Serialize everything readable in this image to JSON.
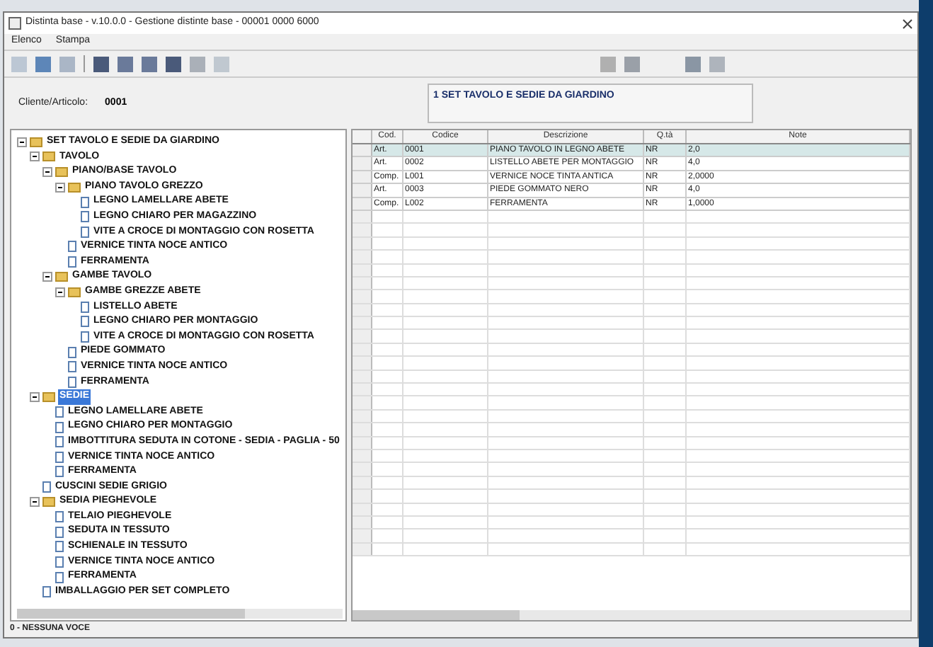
{
  "window": {
    "title": "Distinta base - v.10.0.0 - Gestione distinte base - 00001 0000 6000"
  },
  "menu": [
    "Elenco",
    "Stampa"
  ],
  "header": {
    "label": "Cliente/Articolo:",
    "value": "0001",
    "description": "1 SET TAVOLO E SEDIE DA GIARDINO"
  },
  "tree": [
    {
      "label": "SET TAVOLO E SEDIE DA GIARDINO",
      "kind": "folder",
      "expanded": true,
      "selected": false,
      "children": [
        {
          "label": "TAVOLO",
          "kind": "folder",
          "expanded": true,
          "selected": false,
          "children": [
            {
              "label": "PIANO/BASE TAVOLO",
              "kind": "folder",
              "expanded": true,
              "selected": false,
              "children": [
                {
                  "label": "PIANO TAVOLO GREZZO",
                  "kind": "folder",
                  "expanded": true,
                  "selected": false,
                  "children": [
                    {
                      "label": "LEGNO LAMELLARE ABETE",
                      "kind": "leaf",
                      "selected": false
                    },
                    {
                      "label": "LEGNO CHIARO PER MAGAZZINO",
                      "kind": "leaf",
                      "selected": false
                    },
                    {
                      "label": "VITE A CROCE DI MONTAGGIO CON ROSETTA",
                      "kind": "leaf",
                      "selected": false
                    }
                  ]
                },
                {
                  "label": "VERNICE TINTA NOCE ANTICO",
                  "kind": "leaf",
                  "selected": false
                },
                {
                  "label": "FERRAMENTA",
                  "kind": "leaf",
                  "selected": false
                }
              ]
            },
            {
              "label": "GAMBE TAVOLO",
              "kind": "folder",
              "expanded": true,
              "selected": false,
              "children": [
                {
                  "label": "GAMBE GREZZE ABETE",
                  "kind": "folder",
                  "expanded": true,
                  "selected": false,
                  "children": [
                    {
                      "label": "LISTELLO ABETE",
                      "kind": "leaf",
                      "selected": false
                    },
                    {
                      "label": "LEGNO CHIARO PER MONTAGGIO",
                      "kind": "leaf",
                      "selected": false
                    },
                    {
                      "label": "VITE A CROCE DI MONTAGGIO CON ROSETTA",
                      "kind": "leaf",
                      "selected": false
                    }
                  ]
                },
                {
                  "label": "PIEDE GOMMATO",
                  "kind": "leaf",
                  "selected": false
                },
                {
                  "label": "VERNICE TINTA NOCE ANTICO",
                  "kind": "leaf",
                  "selected": false
                },
                {
                  "label": "FERRAMENTA",
                  "kind": "leaf",
                  "selected": false
                }
              ]
            }
          ]
        },
        {
          "label": "SEDIE",
          "kind": "folder",
          "expanded": true,
          "selected": true,
          "children": [
            {
              "label": "LEGNO LAMELLARE ABETE",
              "kind": "leaf",
              "selected": false
            },
            {
              "label": "LEGNO CHIARO PER MONTAGGIO",
              "kind": "leaf",
              "selected": false
            },
            {
              "label": "IMBOTTITURA SEDUTA IN COTONE - SEDIA - PAGLIA - 50",
              "kind": "leaf",
              "selected": false
            },
            {
              "label": "VERNICE TINTA NOCE ANTICO",
              "kind": "leaf",
              "selected": false
            },
            {
              "label": "FERRAMENTA",
              "kind": "leaf",
              "selected": false
            }
          ]
        },
        {
          "label": "CUSCINI SEDIE GRIGIO",
          "kind": "leaf",
          "selected": false
        },
        {
          "label": "SEDIA PIEGHEVOLE",
          "kind": "folder",
          "expanded": true,
          "selected": false,
          "children": [
            {
              "label": "TELAIO PIEGHEVOLE",
              "kind": "leaf",
              "selected": false
            },
            {
              "label": "SEDUTA IN TESSUTO",
              "kind": "leaf",
              "selected": false
            },
            {
              "label": "SCHIENALE IN TESSUTO",
              "kind": "leaf",
              "selected": false
            },
            {
              "label": "VERNICE TINTA NOCE ANTICO",
              "kind": "leaf",
              "selected": false
            },
            {
              "label": "FERRAMENTA",
              "kind": "leaf",
              "selected": false
            }
          ]
        },
        {
          "label": "IMBALLAGGIO PER SET COMPLETO",
          "kind": "leaf",
          "selected": false
        }
      ]
    }
  ],
  "grid": {
    "columns": [
      "Cod.",
      "Codice",
      "Descrizione",
      "Q.tà",
      "Note"
    ],
    "rows": [
      {
        "cells": [
          "Art.",
          "0001",
          "PIANO TAVOLO IN LEGNO ABETE",
          "NR",
          "2,0"
        ],
        "selected": true
      },
      {
        "cells": [
          "Art.",
          "0002",
          "LISTELLO ABETE PER MONTAGGIO",
          "NR",
          "4,0"
        ],
        "selected": false
      },
      {
        "cells": [
          "Comp.",
          "L001",
          "VERNICE NOCE TINTA ANTICA",
          "NR",
          "2,0000"
        ],
        "selected": false
      },
      {
        "cells": [
          "Art.",
          "0003",
          "PIEDE GOMMATO NERO",
          "NR",
          "4,0"
        ],
        "selected": false
      },
      {
        "cells": [
          "Comp.",
          "L002",
          "FERRAMENTA",
          "NR",
          "1,0000"
        ],
        "selected": false
      }
    ]
  },
  "status_bar": "0 - NESSUNA VOCE"
}
